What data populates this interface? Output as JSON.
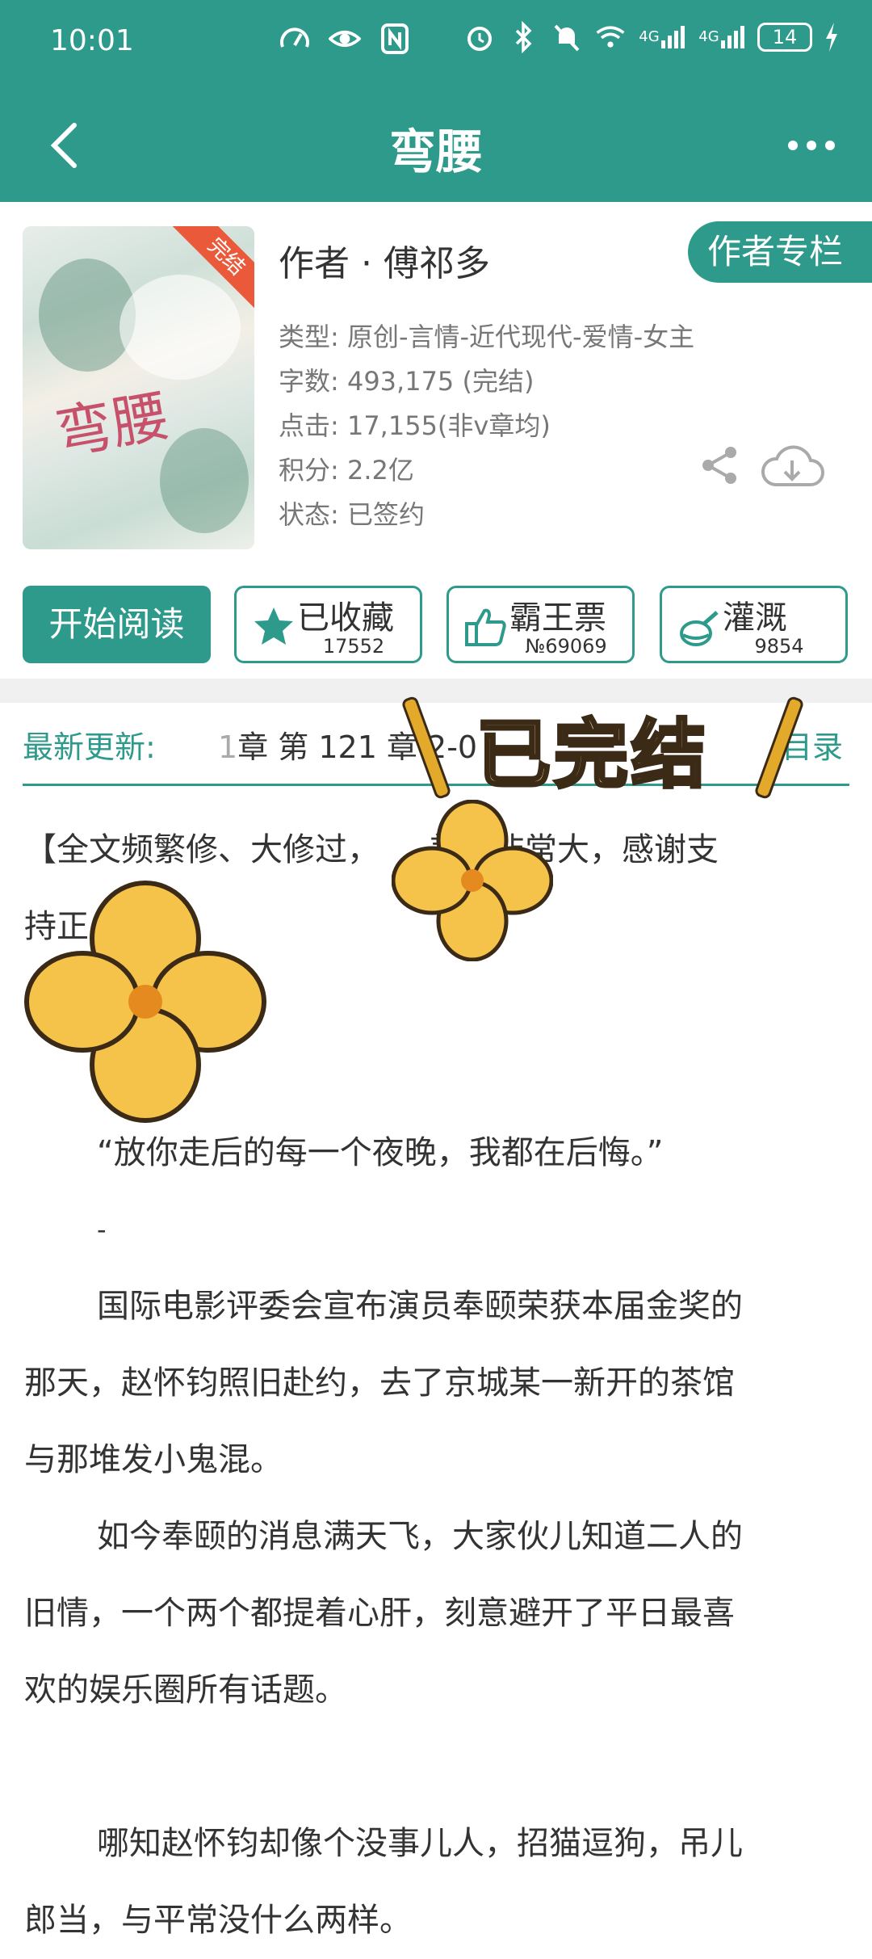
{
  "status_bar": {
    "time": "10:01",
    "network1": "4G",
    "network2": "4G",
    "battery": "14"
  },
  "nav": {
    "title": "弯腰"
  },
  "book": {
    "cover_badge": "完结",
    "cover_title": "弯腰",
    "author": "作者 · 傅祁多",
    "author_column": "作者专栏",
    "type": "类型: 原创-言情-近代现代-爱情-女主",
    "words": "字数: 493,175 (完结)",
    "clicks": "点击: 17,155(非v章均)",
    "score": "积分: 2.2亿",
    "status": "状态: 已签约"
  },
  "actions": {
    "start_reading": "开始阅读",
    "collect": {
      "label": "已收藏",
      "count": "17552"
    },
    "vote": {
      "label": "霸王票",
      "count": "№69069"
    },
    "irrigate": {
      "label": "灌溉",
      "count": "9854"
    }
  },
  "latest": {
    "label": "最新更新:",
    "chapter_fade": "1",
    "chapter": "章  第 121 章  2",
    "chapter_tail": "-0",
    "toc": "目录"
  },
  "sticker": {
    "text": "已完结"
  },
  "content": {
    "p1": "【全文频繁修、大修过，",
    "p1b": "差别非常大，感谢支",
    "p1c": "持正",
    "quote": "“放你走后的每一个夜晚，我都在后悔。”",
    "dash": "-",
    "p2a": "国际电影评委会宣布演员奉颐荣获本届金奖的",
    "p2b": "那天，赵怀钧照旧赴约，去了京城某一新开的茶馆",
    "p2c": "与那堆发小鬼混。",
    "p3a": "如今奉颐的消息满天飞，大家伙儿知道二人的",
    "p3b": "旧情，一个两个都提着心肝，刻意避开了平日最喜",
    "p3c": "欢的娱乐圈所有话题。",
    "p4a": "哪知赵怀钧却像个没事儿人，招猫逗狗，吊儿",
    "p4b": "郎当，与平常没什么两样。"
  },
  "colors": {
    "accent": "#2e9a8b",
    "badge": "#ea5a3a",
    "sticker_fill": "#f6dfa3"
  }
}
